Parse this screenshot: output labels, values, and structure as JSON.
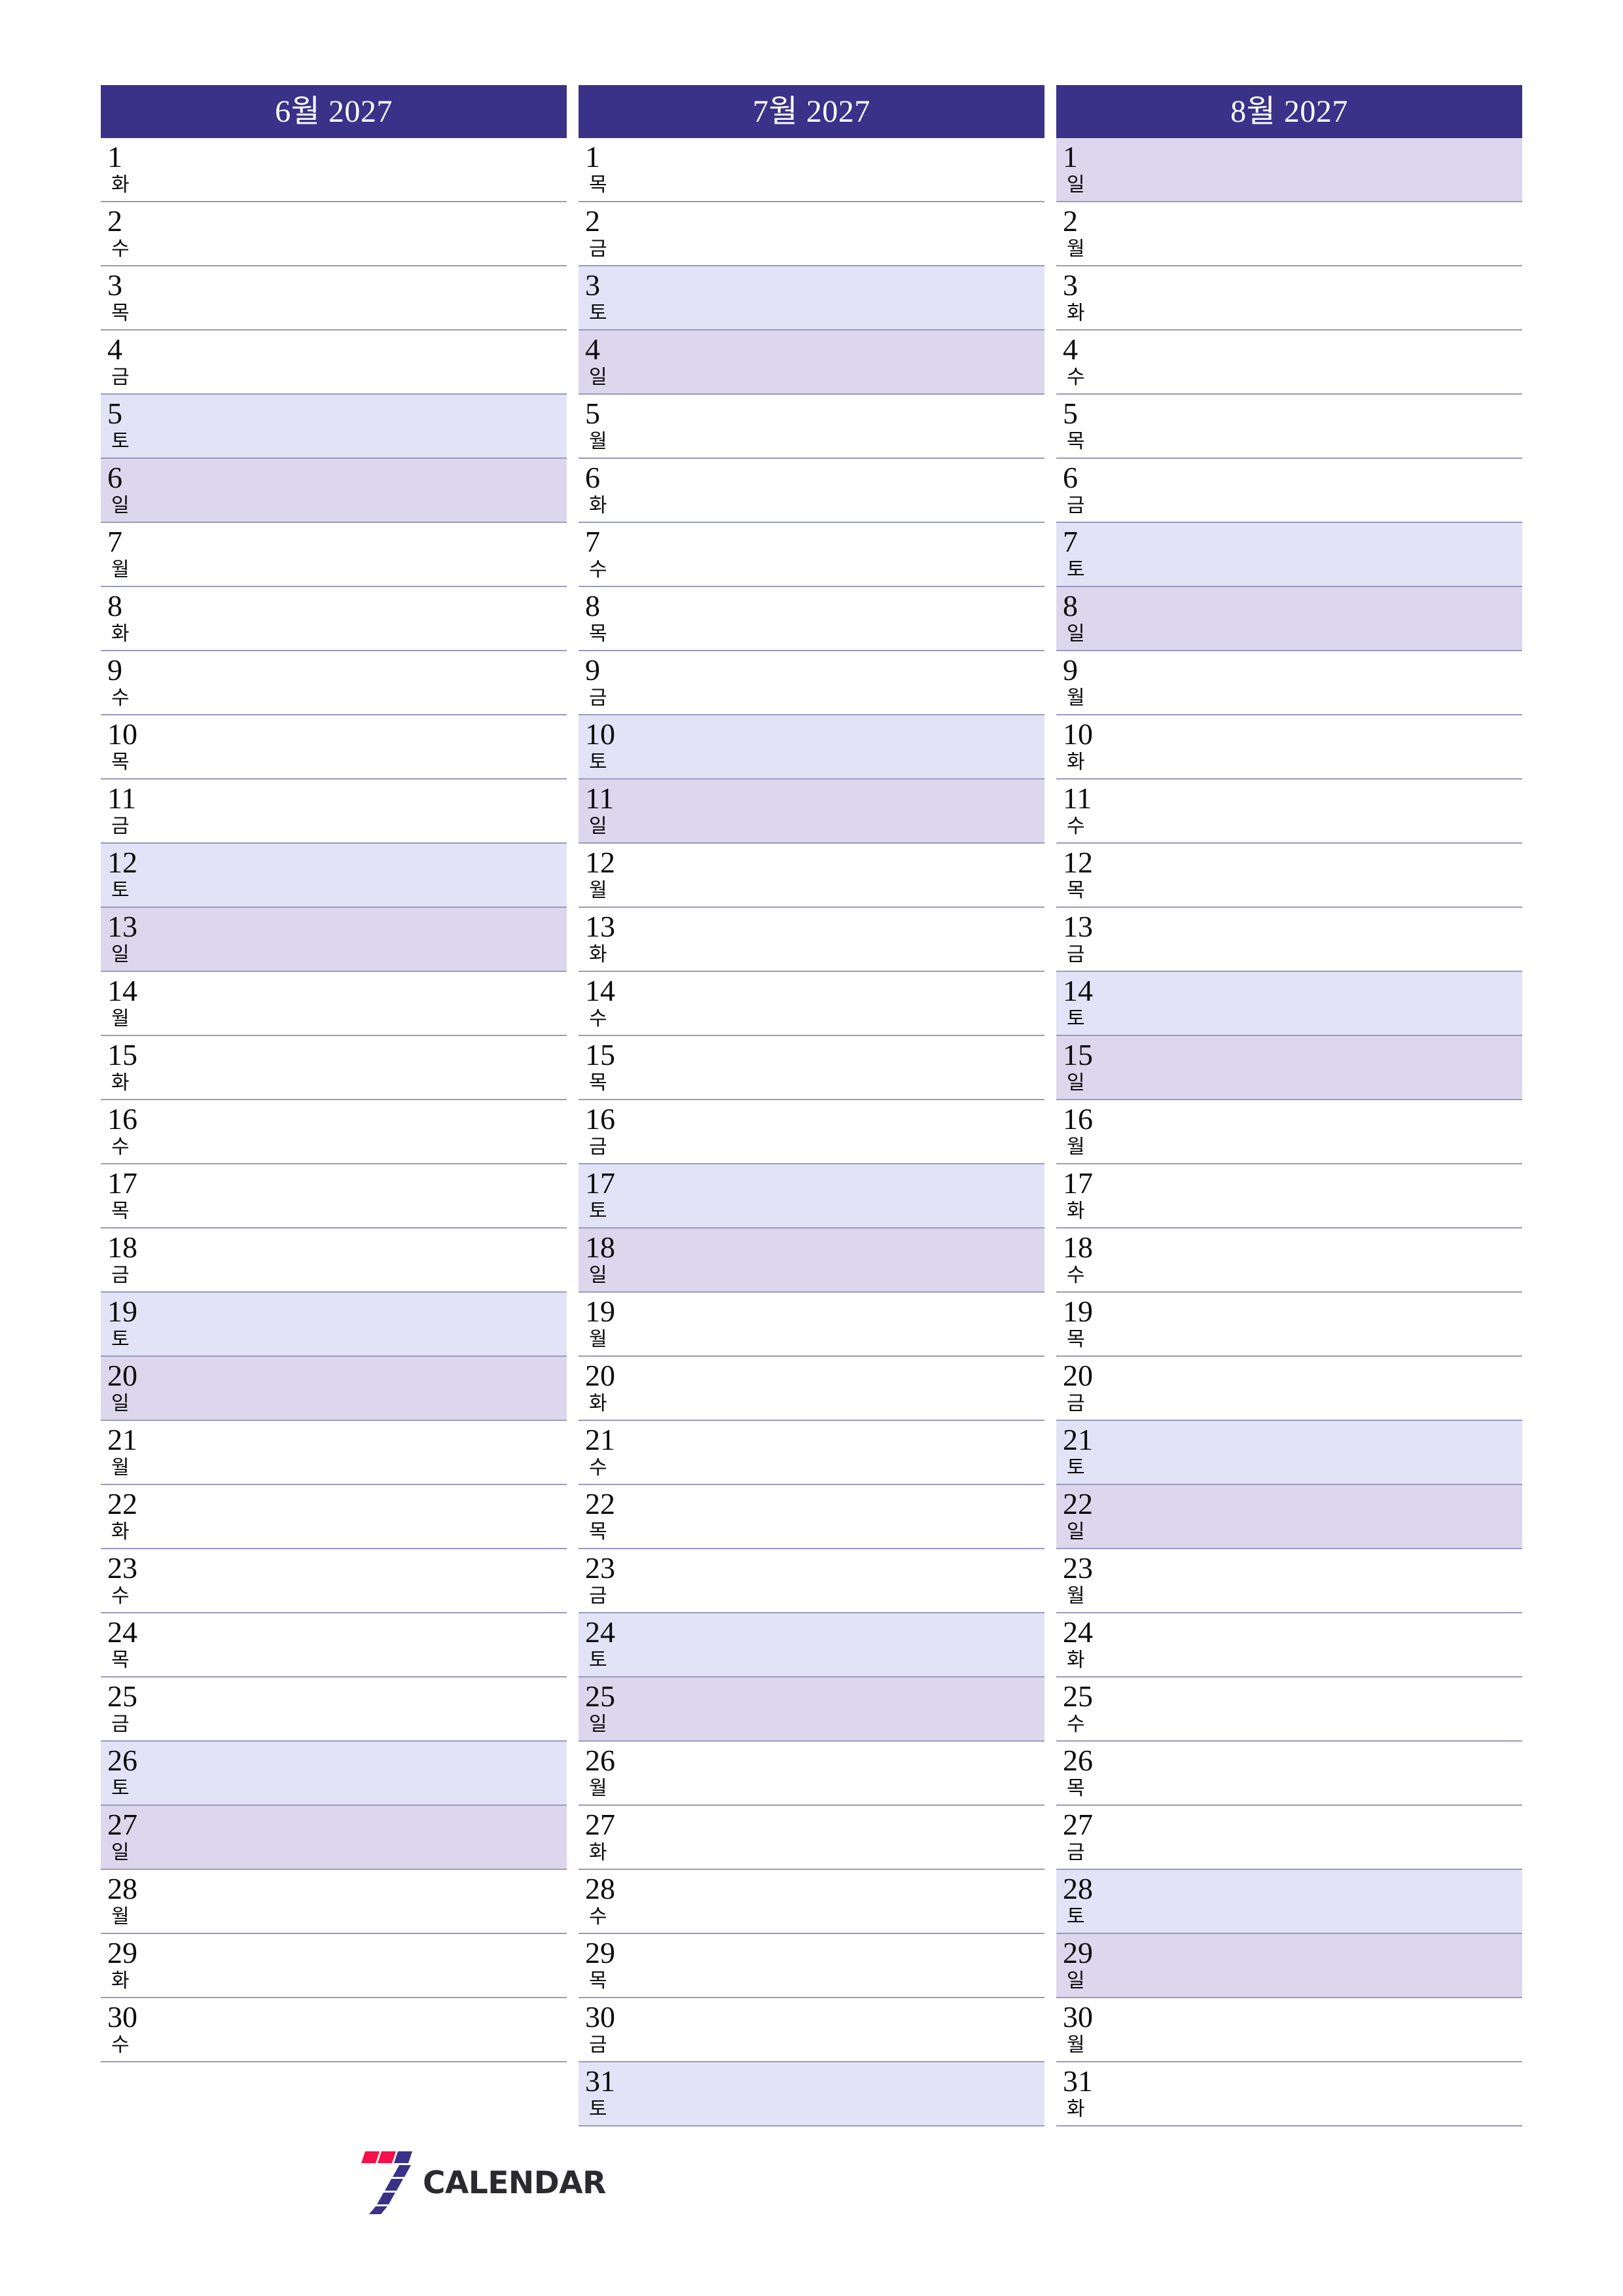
{
  "page": {
    "year": "2027",
    "colors": {
      "header_bg": "#3a3189",
      "header_text": "#ffffff",
      "saturday_bg": "#e2e3f6",
      "sunday_bg": "#dcd7ec",
      "row_divider": "#9a9abd",
      "day_text": "#0b0b0b",
      "logo_red": "#f5104a",
      "logo_blue": "#3a3189",
      "logo_text": "#2b2b2f"
    }
  },
  "logo": {
    "name": "7calendar-logo",
    "text": "CALENDAR",
    "mark": "seven-stripes-icon"
  },
  "months": [
    {
      "title": "6월 2027",
      "name": "june",
      "days": [
        {
          "num": "1",
          "dow": "화",
          "type": "weekday"
        },
        {
          "num": "2",
          "dow": "수",
          "type": "weekday"
        },
        {
          "num": "3",
          "dow": "목",
          "type": "weekday"
        },
        {
          "num": "4",
          "dow": "금",
          "type": "weekday"
        },
        {
          "num": "5",
          "dow": "토",
          "type": "sat"
        },
        {
          "num": "6",
          "dow": "일",
          "type": "sun"
        },
        {
          "num": "7",
          "dow": "월",
          "type": "weekday"
        },
        {
          "num": "8",
          "dow": "화",
          "type": "weekday"
        },
        {
          "num": "9",
          "dow": "수",
          "type": "weekday"
        },
        {
          "num": "10",
          "dow": "목",
          "type": "weekday"
        },
        {
          "num": "11",
          "dow": "금",
          "type": "weekday"
        },
        {
          "num": "12",
          "dow": "토",
          "type": "sat"
        },
        {
          "num": "13",
          "dow": "일",
          "type": "sun"
        },
        {
          "num": "14",
          "dow": "월",
          "type": "weekday"
        },
        {
          "num": "15",
          "dow": "화",
          "type": "weekday"
        },
        {
          "num": "16",
          "dow": "수",
          "type": "weekday"
        },
        {
          "num": "17",
          "dow": "목",
          "type": "weekday"
        },
        {
          "num": "18",
          "dow": "금",
          "type": "weekday"
        },
        {
          "num": "19",
          "dow": "토",
          "type": "sat"
        },
        {
          "num": "20",
          "dow": "일",
          "type": "sun"
        },
        {
          "num": "21",
          "dow": "월",
          "type": "weekday"
        },
        {
          "num": "22",
          "dow": "화",
          "type": "weekday"
        },
        {
          "num": "23",
          "dow": "수",
          "type": "weekday"
        },
        {
          "num": "24",
          "dow": "목",
          "type": "weekday"
        },
        {
          "num": "25",
          "dow": "금",
          "type": "weekday"
        },
        {
          "num": "26",
          "dow": "토",
          "type": "sat"
        },
        {
          "num": "27",
          "dow": "일",
          "type": "sun"
        },
        {
          "num": "28",
          "dow": "월",
          "type": "weekday"
        },
        {
          "num": "29",
          "dow": "화",
          "type": "weekday"
        },
        {
          "num": "30",
          "dow": "수",
          "type": "weekday"
        }
      ]
    },
    {
      "title": "7월 2027",
      "name": "july",
      "days": [
        {
          "num": "1",
          "dow": "목",
          "type": "weekday"
        },
        {
          "num": "2",
          "dow": "금",
          "type": "weekday"
        },
        {
          "num": "3",
          "dow": "토",
          "type": "sat"
        },
        {
          "num": "4",
          "dow": "일",
          "type": "sun"
        },
        {
          "num": "5",
          "dow": "월",
          "type": "weekday"
        },
        {
          "num": "6",
          "dow": "화",
          "type": "weekday"
        },
        {
          "num": "7",
          "dow": "수",
          "type": "weekday"
        },
        {
          "num": "8",
          "dow": "목",
          "type": "weekday"
        },
        {
          "num": "9",
          "dow": "금",
          "type": "weekday"
        },
        {
          "num": "10",
          "dow": "토",
          "type": "sat"
        },
        {
          "num": "11",
          "dow": "일",
          "type": "sun"
        },
        {
          "num": "12",
          "dow": "월",
          "type": "weekday"
        },
        {
          "num": "13",
          "dow": "화",
          "type": "weekday"
        },
        {
          "num": "14",
          "dow": "수",
          "type": "weekday"
        },
        {
          "num": "15",
          "dow": "목",
          "type": "weekday"
        },
        {
          "num": "16",
          "dow": "금",
          "type": "weekday"
        },
        {
          "num": "17",
          "dow": "토",
          "type": "sat"
        },
        {
          "num": "18",
          "dow": "일",
          "type": "sun"
        },
        {
          "num": "19",
          "dow": "월",
          "type": "weekday"
        },
        {
          "num": "20",
          "dow": "화",
          "type": "weekday"
        },
        {
          "num": "21",
          "dow": "수",
          "type": "weekday"
        },
        {
          "num": "22",
          "dow": "목",
          "type": "weekday"
        },
        {
          "num": "23",
          "dow": "금",
          "type": "weekday"
        },
        {
          "num": "24",
          "dow": "토",
          "type": "sat"
        },
        {
          "num": "25",
          "dow": "일",
          "type": "sun"
        },
        {
          "num": "26",
          "dow": "월",
          "type": "weekday"
        },
        {
          "num": "27",
          "dow": "화",
          "type": "weekday"
        },
        {
          "num": "28",
          "dow": "수",
          "type": "weekday"
        },
        {
          "num": "29",
          "dow": "목",
          "type": "weekday"
        },
        {
          "num": "30",
          "dow": "금",
          "type": "weekday"
        },
        {
          "num": "31",
          "dow": "토",
          "type": "sat"
        }
      ]
    },
    {
      "title": "8월 2027",
      "name": "august",
      "days": [
        {
          "num": "1",
          "dow": "일",
          "type": "sun"
        },
        {
          "num": "2",
          "dow": "월",
          "type": "weekday"
        },
        {
          "num": "3",
          "dow": "화",
          "type": "weekday"
        },
        {
          "num": "4",
          "dow": "수",
          "type": "weekday"
        },
        {
          "num": "5",
          "dow": "목",
          "type": "weekday"
        },
        {
          "num": "6",
          "dow": "금",
          "type": "weekday"
        },
        {
          "num": "7",
          "dow": "토",
          "type": "sat"
        },
        {
          "num": "8",
          "dow": "일",
          "type": "sun"
        },
        {
          "num": "9",
          "dow": "월",
          "type": "weekday"
        },
        {
          "num": "10",
          "dow": "화",
          "type": "weekday"
        },
        {
          "num": "11",
          "dow": "수",
          "type": "weekday"
        },
        {
          "num": "12",
          "dow": "목",
          "type": "weekday"
        },
        {
          "num": "13",
          "dow": "금",
          "type": "weekday"
        },
        {
          "num": "14",
          "dow": "토",
          "type": "sat"
        },
        {
          "num": "15",
          "dow": "일",
          "type": "sun"
        },
        {
          "num": "16",
          "dow": "월",
          "type": "weekday"
        },
        {
          "num": "17",
          "dow": "화",
          "type": "weekday"
        },
        {
          "num": "18",
          "dow": "수",
          "type": "weekday"
        },
        {
          "num": "19",
          "dow": "목",
          "type": "weekday"
        },
        {
          "num": "20",
          "dow": "금",
          "type": "weekday"
        },
        {
          "num": "21",
          "dow": "토",
          "type": "sat"
        },
        {
          "num": "22",
          "dow": "일",
          "type": "sun"
        },
        {
          "num": "23",
          "dow": "월",
          "type": "weekday"
        },
        {
          "num": "24",
          "dow": "화",
          "type": "weekday"
        },
        {
          "num": "25",
          "dow": "수",
          "type": "weekday"
        },
        {
          "num": "26",
          "dow": "목",
          "type": "weekday"
        },
        {
          "num": "27",
          "dow": "금",
          "type": "weekday"
        },
        {
          "num": "28",
          "dow": "토",
          "type": "sat"
        },
        {
          "num": "29",
          "dow": "일",
          "type": "sun"
        },
        {
          "num": "30",
          "dow": "월",
          "type": "weekday"
        },
        {
          "num": "31",
          "dow": "화",
          "type": "weekday"
        }
      ]
    }
  ]
}
